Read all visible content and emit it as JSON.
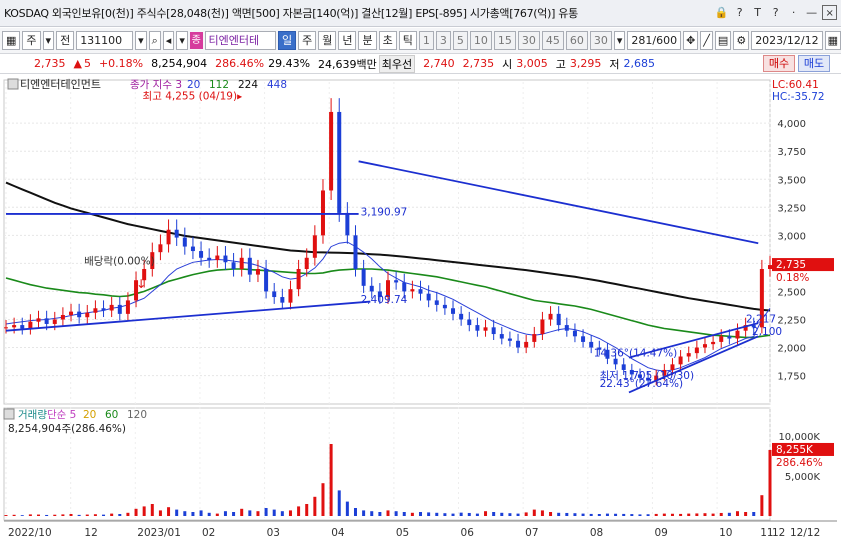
{
  "header": {
    "info": "KOSDAQ 외국인보유[0(천)] 주식수[28,048(천)] 액면[500] 자본금[140(억)] 결산[12월] EPS[-895] 시가총액[767(억)] 유통",
    "icons": [
      "lock-icon",
      "help-icon",
      "text-icon",
      "question-icon",
      "settings-icon",
      "minimize-icon",
      "close-icon"
    ],
    "win_glyphs": [
      "🔒",
      "?",
      "T",
      "?",
      "·",
      "—",
      "×"
    ]
  },
  "toolbar": {
    "market": "주",
    "chart_kind": "전",
    "code": "131100",
    "badge": "종",
    "stock_name": "티엔엔터테",
    "periods": [
      "일",
      "주",
      "월",
      "년",
      "분",
      "초",
      "틱"
    ],
    "active_period": "일",
    "intervals": [
      "1",
      "3",
      "5",
      "10",
      "15",
      "30",
      "45",
      "60"
    ],
    "interval_select": "30",
    "count": "281",
    "count_total": "/600",
    "date": "2023/12/12"
  },
  "quote": {
    "price": "2,735",
    "change_sign": "▲",
    "change": "5",
    "change_pct": "+0.18%",
    "volume": "8,254,904",
    "volume_ratio": "286.46%",
    "turnover": "29.43%",
    "amount": "24,639백만",
    "priority_label": "최우선",
    "ask": "2,740",
    "bid": "2,735",
    "open_label": "시",
    "open": "3,005",
    "high_label": "고",
    "high": "3,295",
    "low_label": "저",
    "low": "2,685",
    "buy_label": "매수",
    "sell_label": "매도"
  },
  "chart_data": [
    {
      "type": "candlestick",
      "title": "티엔엔터테인먼트",
      "legend": [
        {
          "label": "종가 지수 3",
          "color": "#a020a0"
        },
        {
          "label": "20",
          "color": "#2a3fd8"
        },
        {
          "label": "112",
          "color": "#1a8a1a"
        },
        {
          "label": "224",
          "color": "#111111"
        },
        {
          "label": "448",
          "color": "#2a3fd8"
        }
      ],
      "xticks": [
        "2022/10",
        "12",
        "2023/01",
        "02",
        "03",
        "04",
        "05",
        "06",
        "07",
        "08",
        "09",
        "10",
        "11",
        "12",
        "12/12"
      ],
      "yticks": [
        "4,000",
        "3,750",
        "3,500",
        "3,250",
        "3,000",
        "2,750",
        "2,500",
        "2,250",
        "2,000",
        "1,750"
      ],
      "ylim": [
        1550,
        4260
      ],
      "corner_labels": [
        "LC:60.41",
        "HC:-35.72"
      ],
      "current_price": "2,735",
      "current_change": "0.18%",
      "annotations": [
        "최고 4,255 (04/19)",
        "3,190.97",
        "2,409.74",
        "배당락(0.00%)",
        "14.36°(14.47%)",
        "최저 1,705 (10/30)",
        "22.43°(27.64%)",
        "2,217",
        "2,100"
      ],
      "close": [
        2180,
        2200,
        2170,
        2230,
        2260,
        2210,
        2250,
        2290,
        2320,
        2270,
        2310,
        2350,
        2330,
        2380,
        2300,
        2420,
        2600,
        2700,
        2850,
        2920,
        3050,
        2980,
        2900,
        2860,
        2800,
        2780,
        2820,
        2760,
        2700,
        2800,
        2650,
        2700,
        2500,
        2450,
        2400,
        2520,
        2700,
        2800,
        3000,
        3400,
        4100,
        3200,
        3000,
        2700,
        2550,
        2500,
        2450,
        2600,
        2580,
        2500,
        2520,
        2480,
        2420,
        2380,
        2350,
        2300,
        2250,
        2200,
        2150,
        2180,
        2120,
        2080,
        2060,
        2000,
        2050,
        2120,
        2250,
        2300,
        2200,
        2150,
        2100,
        2050,
        2000,
        1980,
        1900,
        1850,
        1800,
        1760,
        1730,
        1705,
        1750,
        1800,
        1850,
        1920,
        1950,
        2000,
        2030,
        2050,
        2100,
        2080,
        2150,
        2200,
        2180,
        2700,
        2735
      ],
      "ma20": [
        2210,
        2220,
        2230,
        2240,
        2245,
        2250,
        2260,
        2270,
        2285,
        2300,
        2310,
        2320,
        2330,
        2350,
        2360,
        2380,
        2410,
        2440,
        2500,
        2560,
        2640,
        2700,
        2730,
        2760,
        2770,
        2780,
        2785,
        2780,
        2770,
        2760,
        2750,
        2730,
        2700,
        2670,
        2630,
        2610,
        2620,
        2660,
        2710,
        2790,
        2900,
        2930,
        2940,
        2900,
        2850,
        2790,
        2720,
        2660,
        2620,
        2580,
        2560,
        2540,
        2510,
        2490,
        2460,
        2430,
        2390,
        2350,
        2310,
        2270,
        2230,
        2200,
        2170,
        2140,
        2120,
        2110,
        2120,
        2140,
        2160,
        2170,
        2160,
        2140,
        2110,
        2080,
        2040,
        2000,
        1950,
        1900,
        1860,
        1820,
        1800,
        1790,
        1800,
        1820,
        1850,
        1880,
        1910,
        1950,
        1990,
        2020,
        2050,
        2080,
        2100,
        2250,
        2350
      ],
      "ma112": [
        2620,
        2600,
        2580,
        2560,
        2545,
        2530,
        2520,
        2510,
        2500,
        2490,
        2485,
        2475,
        2470,
        2460,
        2455,
        2460,
        2480,
        2500,
        2530,
        2560,
        2590,
        2610,
        2630,
        2650,
        2665,
        2680,
        2690,
        2695,
        2700,
        2700,
        2695,
        2690,
        2685,
        2680,
        2675,
        2670,
        2665,
        2660,
        2660,
        2665,
        2680,
        2690,
        2695,
        2700,
        2700,
        2700,
        2695,
        2690,
        2680,
        2670,
        2660,
        2650,
        2640,
        2630,
        2615,
        2600,
        2585,
        2570,
        2555,
        2540,
        2520,
        2500,
        2480,
        2460,
        2440,
        2420,
        2410,
        2400,
        2390,
        2380,
        2370,
        2355,
        2340,
        2320,
        2300,
        2280,
        2260,
        2240,
        2220,
        2200,
        2185,
        2170,
        2160,
        2150,
        2140,
        2130,
        2120,
        2110,
        2105,
        2100,
        2095,
        2090,
        2090,
        2100,
        2110
      ],
      "ma224": [
        3470,
        3440,
        3410,
        3380,
        3350,
        3320,
        3290,
        3265,
        3240,
        3220,
        3200,
        3180,
        3160,
        3140,
        3120,
        3100,
        3085,
        3070,
        3055,
        3040,
        3025,
        3010,
        2995,
        2985,
        2975,
        2965,
        2955,
        2945,
        2935,
        2925,
        2915,
        2905,
        2895,
        2885,
        2875,
        2865,
        2860,
        2855,
        2850,
        2848,
        2846,
        2845,
        2843,
        2840,
        2836,
        2832,
        2828,
        2822,
        2816,
        2810,
        2802,
        2794,
        2786,
        2778,
        2770,
        2762,
        2754,
        2746,
        2738,
        2730,
        2722,
        2714,
        2706,
        2698,
        2690,
        2680,
        2670,
        2660,
        2650,
        2640,
        2630,
        2618,
        2606,
        2594,
        2580,
        2566,
        2552,
        2538,
        2524,
        2510,
        2496,
        2482,
        2468,
        2454,
        2440,
        2428,
        2416,
        2404,
        2392,
        2380,
        2368,
        2356,
        2344,
        2335,
        2330
      ],
      "trendlines": [
        {
          "from": [
            0,
            3190.97
          ],
          "to": [
            60,
            3190.97
          ]
        },
        {
          "from": [
            0,
            2150
          ],
          "to": [
            62,
            2409.74
          ]
        },
        {
          "from": [
            60,
            3660
          ],
          "to": [
            128,
            2930
          ]
        },
        {
          "from": [
            106,
            1910
          ],
          "to": [
            128,
            2217
          ]
        },
        {
          "from": [
            106,
            1600
          ],
          "to": [
            128,
            2100
          ]
        }
      ]
    },
    {
      "type": "bar",
      "title": "거래량",
      "legend": [
        {
          "label": "거래량",
          "color": "#1a8a8a"
        },
        {
          "label": "단순 5",
          "color": "#c040c0"
        },
        {
          "label": "20",
          "color": "#d4a000"
        },
        {
          "label": "60",
          "color": "#1a8a1a"
        },
        {
          "label": "120",
          "color": "#666666"
        }
      ],
      "summary": "8,254,904주(286.46%)",
      "yticks": [
        "10,000K",
        "5,000K"
      ],
      "current_volume": "8,255K",
      "current_ratio": "286.46%",
      "values": [
        120,
        150,
        100,
        200,
        180,
        130,
        160,
        200,
        250,
        140,
        180,
        220,
        170,
        300,
        250,
        400,
        900,
        1200,
        1500,
        700,
        1100,
        800,
        600,
        500,
        700,
        400,
        300,
        600,
        500,
        900,
        700,
        600,
        1000,
        800,
        600,
        700,
        1200,
        1500,
        2400,
        4100,
        9000,
        3200,
        1800,
        1000,
        700,
        600,
        500,
        700,
        600,
        500,
        400,
        500,
        450,
        400,
        350,
        300,
        420,
        380,
        300,
        600,
        500,
        400,
        350,
        300,
        450,
        800,
        700,
        500,
        400,
        380,
        350,
        300,
        260,
        250,
        300,
        280,
        260,
        240,
        200,
        220,
        260,
        300,
        280,
        260,
        300,
        320,
        350,
        300,
        380,
        400,
        600,
        500,
        500,
        2600,
        8255
      ]
    }
  ]
}
